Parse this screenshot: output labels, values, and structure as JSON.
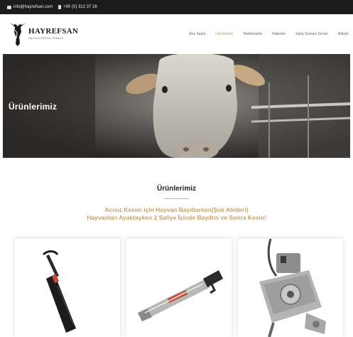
{
  "topbar": {
    "email": "info@hayrefsan.com",
    "phone": "+90 (0) 312 37 28",
    "email_icon": "envelope-icon",
    "phone_icon": "phone-icon"
  },
  "header": {
    "brand_name": "HAYREFSAN",
    "brand_tagline": "HAYVAN REFAHI SANAYİİ",
    "logo_icon": "bull-head-icon",
    "nav": [
      {
        "label": "Ana Sayfa",
        "active": false
      },
      {
        "label": "Ürünlerimiz",
        "active": true
      },
      {
        "label": "Hakkımızda",
        "active": false
      },
      {
        "label": "Haberler",
        "active": false
      },
      {
        "label": "Satış Sonrası Servis",
        "active": false
      },
      {
        "label": "İletişim",
        "active": false
      }
    ]
  },
  "hero": {
    "title": "Ürünlerimiz"
  },
  "products_section": {
    "title": "Ürünlerimiz",
    "subtitle_line1": "Acısız Kesim için Hayvan Bayıltanları(Şok Aletleri)",
    "subtitle_line2": "Hayvanları Ayaktayken 2 Saliye İçinde Bayıltın ve Sonra Kesin!"
  },
  "products": [
    {
      "image": "stun-tool-handle-image"
    },
    {
      "image": "captive-bolt-pistol-image"
    },
    {
      "image": "pneumatic-stunner-image"
    }
  ],
  "colors": {
    "accent_gold": "#c7a264",
    "topbar_bg": "#1b1b1b",
    "nav_active": "#a99b6f"
  }
}
